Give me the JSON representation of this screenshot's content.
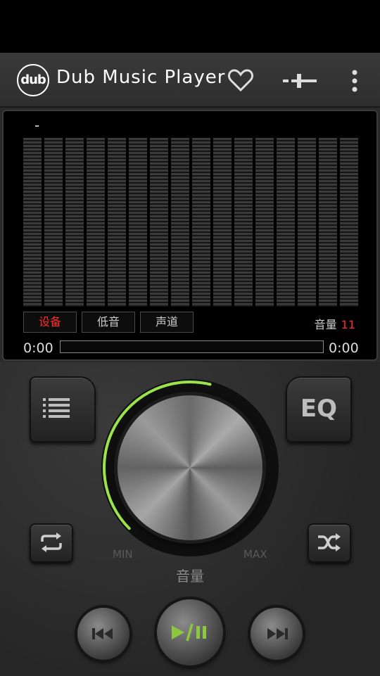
{
  "app": {
    "logo_text": "dub",
    "title": "Dub Music Player"
  },
  "icons": {
    "favorite": "heart-icon",
    "balance": "balance-slider-icon",
    "overflow": "more-vertical-icon",
    "playlist": "list-icon",
    "repeat": "repeat-icon",
    "shuffle": "shuffle-icon",
    "previous": "skip-previous-icon",
    "play_pause": "play-pause-icon",
    "next": "skip-next-icon"
  },
  "visualizer": {
    "track_name": "-",
    "band_count": 16,
    "buttons": [
      {
        "label": "设备",
        "active": true
      },
      {
        "label": "低音",
        "active": false
      },
      {
        "label": "声道",
        "active": false
      }
    ],
    "volume_label": "音量",
    "volume_value": "11",
    "elapsed": "0:00",
    "duration": "0:00",
    "progress_fraction": 0
  },
  "controls": {
    "eq_label": "EQ",
    "knob_min": "MIN",
    "knob_max": "MAX",
    "knob_label": "音量",
    "knob_level_fraction": 0.55
  },
  "colors": {
    "accent_green": "#9be34a",
    "active_red": "#ff2a2a",
    "play_green": "#8dc63f"
  }
}
